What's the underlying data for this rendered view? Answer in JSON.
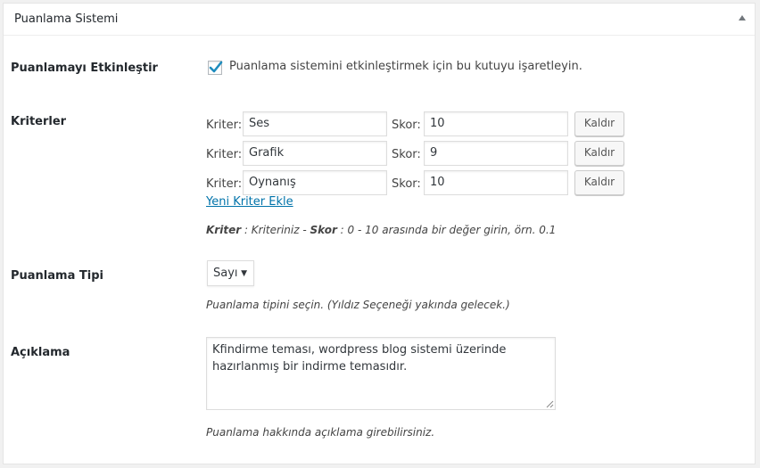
{
  "metabox": {
    "title": "Puanlama Sistemi"
  },
  "enable": {
    "label": "Puanlamayı Etkinleştir",
    "checked": true,
    "description": "Puanlama sistemini etkinleştirmek için bu kutuyu işaretleyin."
  },
  "criteria": {
    "label": "Kriterler",
    "rows": [
      {
        "crit_label": "Kriter:",
        "crit_value": "Ses",
        "score_label": "Skor:",
        "score_value": "10",
        "remove_label": "Kaldır"
      },
      {
        "crit_label": "Kriter:",
        "crit_value": "Grafik",
        "score_label": "Skor:",
        "score_value": "9",
        "remove_label": "Kaldır"
      },
      {
        "crit_label": "Kriter:",
        "crit_value": "Oynanış",
        "score_label": "Skor:",
        "score_value": "10",
        "remove_label": "Kaldır"
      }
    ],
    "add_link": "Yeni Kriter Ekle",
    "help_bold1": "Kriter",
    "help_text1": " : Kriteriniz - ",
    "help_bold2": "Skor",
    "help_text2": " : 0 - 10 arasında bir değer girin, örn. 0.1"
  },
  "rating_type": {
    "label": "Puanlama Tipi",
    "selected": "Sayı",
    "description": "Puanlama tipini seçin. (Yıldız Seçeneği yakında gelecek.)"
  },
  "description_field": {
    "label": "Açıklama",
    "value": "Kfindirme teması, wordpress blog sistemi üzerinde hazırlanmış bir indirme temasıdır.",
    "help": "Puanlama hakkında açıklama girebilirsiniz."
  }
}
